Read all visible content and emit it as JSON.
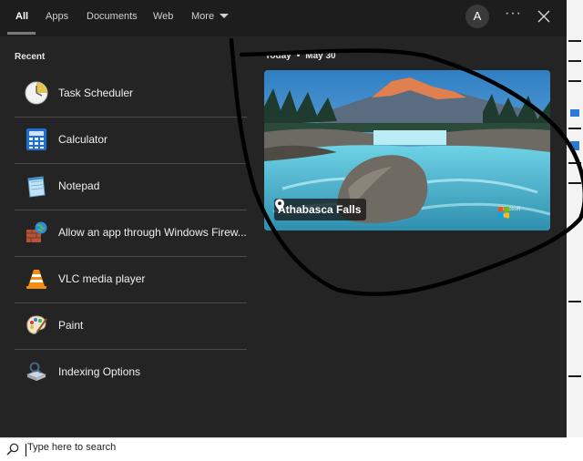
{
  "tabs": {
    "all": "All",
    "apps": "Apps",
    "documents": "Documents",
    "web": "Web",
    "more": "More"
  },
  "user": {
    "avatar_initial": "A"
  },
  "header": {
    "more_options": "···"
  },
  "recent": {
    "heading": "Recent",
    "items": [
      {
        "label": "Task Scheduler",
        "icon": "task-scheduler-icon"
      },
      {
        "label": "Calculator",
        "icon": "calculator-icon"
      },
      {
        "label": "Notepad",
        "icon": "notepad-icon"
      },
      {
        "label": "Allow an app through Windows Firew...",
        "icon": "firewall-icon"
      },
      {
        "label": "VLC media player",
        "icon": "vlc-icon"
      },
      {
        "label": "Paint",
        "icon": "paint-icon"
      },
      {
        "label": "Indexing Options",
        "icon": "indexing-options-icon"
      }
    ]
  },
  "today": {
    "label": "Today",
    "separator": "•",
    "date": "May 30",
    "card_location": "Athabasca Falls",
    "brand_line1": "Microsoft",
    "brand_line2": "Bing"
  },
  "search": {
    "placeholder": "Type here to search"
  },
  "colors": {
    "panel_bg": "#242424",
    "topbar_bg": "#1d1d1d",
    "separator": "#4a4a4a",
    "scribble": "#000000"
  }
}
